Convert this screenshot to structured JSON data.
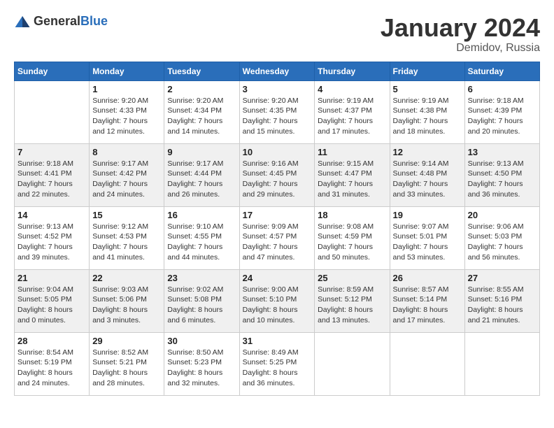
{
  "logo": {
    "general": "General",
    "blue": "Blue"
  },
  "header": {
    "month": "January 2024",
    "location": "Demidov, Russia"
  },
  "weekdays": [
    "Sunday",
    "Monday",
    "Tuesday",
    "Wednesday",
    "Thursday",
    "Friday",
    "Saturday"
  ],
  "weeks": [
    [
      {
        "day": "",
        "info": ""
      },
      {
        "day": "1",
        "info": "Sunrise: 9:20 AM\nSunset: 4:33 PM\nDaylight: 7 hours\nand 12 minutes."
      },
      {
        "day": "2",
        "info": "Sunrise: 9:20 AM\nSunset: 4:34 PM\nDaylight: 7 hours\nand 14 minutes."
      },
      {
        "day": "3",
        "info": "Sunrise: 9:20 AM\nSunset: 4:35 PM\nDaylight: 7 hours\nand 15 minutes."
      },
      {
        "day": "4",
        "info": "Sunrise: 9:19 AM\nSunset: 4:37 PM\nDaylight: 7 hours\nand 17 minutes."
      },
      {
        "day": "5",
        "info": "Sunrise: 9:19 AM\nSunset: 4:38 PM\nDaylight: 7 hours\nand 18 minutes."
      },
      {
        "day": "6",
        "info": "Sunrise: 9:18 AM\nSunset: 4:39 PM\nDaylight: 7 hours\nand 20 minutes."
      }
    ],
    [
      {
        "day": "7",
        "info": "Sunrise: 9:18 AM\nSunset: 4:41 PM\nDaylight: 7 hours\nand 22 minutes."
      },
      {
        "day": "8",
        "info": "Sunrise: 9:17 AM\nSunset: 4:42 PM\nDaylight: 7 hours\nand 24 minutes."
      },
      {
        "day": "9",
        "info": "Sunrise: 9:17 AM\nSunset: 4:44 PM\nDaylight: 7 hours\nand 26 minutes."
      },
      {
        "day": "10",
        "info": "Sunrise: 9:16 AM\nSunset: 4:45 PM\nDaylight: 7 hours\nand 29 minutes."
      },
      {
        "day": "11",
        "info": "Sunrise: 9:15 AM\nSunset: 4:47 PM\nDaylight: 7 hours\nand 31 minutes."
      },
      {
        "day": "12",
        "info": "Sunrise: 9:14 AM\nSunset: 4:48 PM\nDaylight: 7 hours\nand 33 minutes."
      },
      {
        "day": "13",
        "info": "Sunrise: 9:13 AM\nSunset: 4:50 PM\nDaylight: 7 hours\nand 36 minutes."
      }
    ],
    [
      {
        "day": "14",
        "info": "Sunrise: 9:13 AM\nSunset: 4:52 PM\nDaylight: 7 hours\nand 39 minutes."
      },
      {
        "day": "15",
        "info": "Sunrise: 9:12 AM\nSunset: 4:53 PM\nDaylight: 7 hours\nand 41 minutes."
      },
      {
        "day": "16",
        "info": "Sunrise: 9:10 AM\nSunset: 4:55 PM\nDaylight: 7 hours\nand 44 minutes."
      },
      {
        "day": "17",
        "info": "Sunrise: 9:09 AM\nSunset: 4:57 PM\nDaylight: 7 hours\nand 47 minutes."
      },
      {
        "day": "18",
        "info": "Sunrise: 9:08 AM\nSunset: 4:59 PM\nDaylight: 7 hours\nand 50 minutes."
      },
      {
        "day": "19",
        "info": "Sunrise: 9:07 AM\nSunset: 5:01 PM\nDaylight: 7 hours\nand 53 minutes."
      },
      {
        "day": "20",
        "info": "Sunrise: 9:06 AM\nSunset: 5:03 PM\nDaylight: 7 hours\nand 56 minutes."
      }
    ],
    [
      {
        "day": "21",
        "info": "Sunrise: 9:04 AM\nSunset: 5:05 PM\nDaylight: 8 hours\nand 0 minutes."
      },
      {
        "day": "22",
        "info": "Sunrise: 9:03 AM\nSunset: 5:06 PM\nDaylight: 8 hours\nand 3 minutes."
      },
      {
        "day": "23",
        "info": "Sunrise: 9:02 AM\nSunset: 5:08 PM\nDaylight: 8 hours\nand 6 minutes."
      },
      {
        "day": "24",
        "info": "Sunrise: 9:00 AM\nSunset: 5:10 PM\nDaylight: 8 hours\nand 10 minutes."
      },
      {
        "day": "25",
        "info": "Sunrise: 8:59 AM\nSunset: 5:12 PM\nDaylight: 8 hours\nand 13 minutes."
      },
      {
        "day": "26",
        "info": "Sunrise: 8:57 AM\nSunset: 5:14 PM\nDaylight: 8 hours\nand 17 minutes."
      },
      {
        "day": "27",
        "info": "Sunrise: 8:55 AM\nSunset: 5:16 PM\nDaylight: 8 hours\nand 21 minutes."
      }
    ],
    [
      {
        "day": "28",
        "info": "Sunrise: 8:54 AM\nSunset: 5:19 PM\nDaylight: 8 hours\nand 24 minutes."
      },
      {
        "day": "29",
        "info": "Sunrise: 8:52 AM\nSunset: 5:21 PM\nDaylight: 8 hours\nand 28 minutes."
      },
      {
        "day": "30",
        "info": "Sunrise: 8:50 AM\nSunset: 5:23 PM\nDaylight: 8 hours\nand 32 minutes."
      },
      {
        "day": "31",
        "info": "Sunrise: 8:49 AM\nSunset: 5:25 PM\nDaylight: 8 hours\nand 36 minutes."
      },
      {
        "day": "",
        "info": ""
      },
      {
        "day": "",
        "info": ""
      },
      {
        "day": "",
        "info": ""
      }
    ]
  ]
}
